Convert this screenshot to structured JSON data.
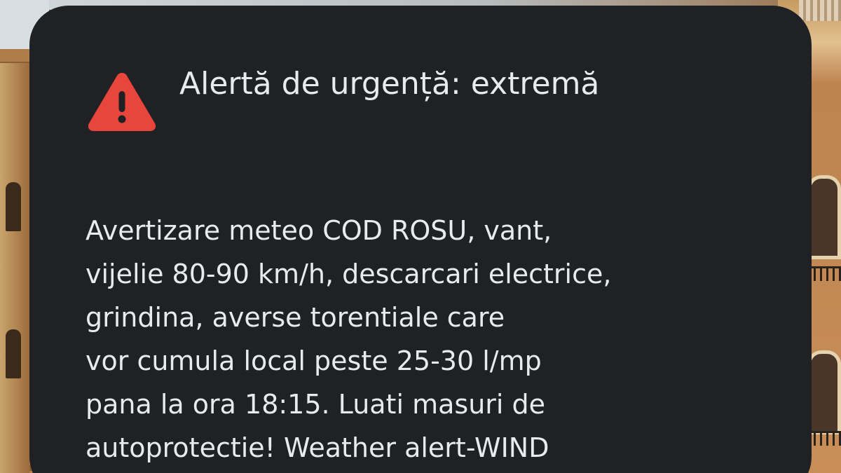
{
  "alert": {
    "icon": "warning-triangle-icon",
    "icon_color": "#e8453c",
    "card_color": "#202124",
    "text_color": "#e8eaed",
    "title": "Alertă de urgență: extremă",
    "body_lines": [
      "Avertizare meteo COD ROSU, vant,",
      "vijelie 80-90 km/h, descarcari electrice,",
      "grindina, averse torentiale care",
      "vor cumula local peste 25-30 l/mp",
      "pana la ora 18:15. Luati masuri de",
      "autoprotectie! Weather alert-WIND"
    ]
  }
}
